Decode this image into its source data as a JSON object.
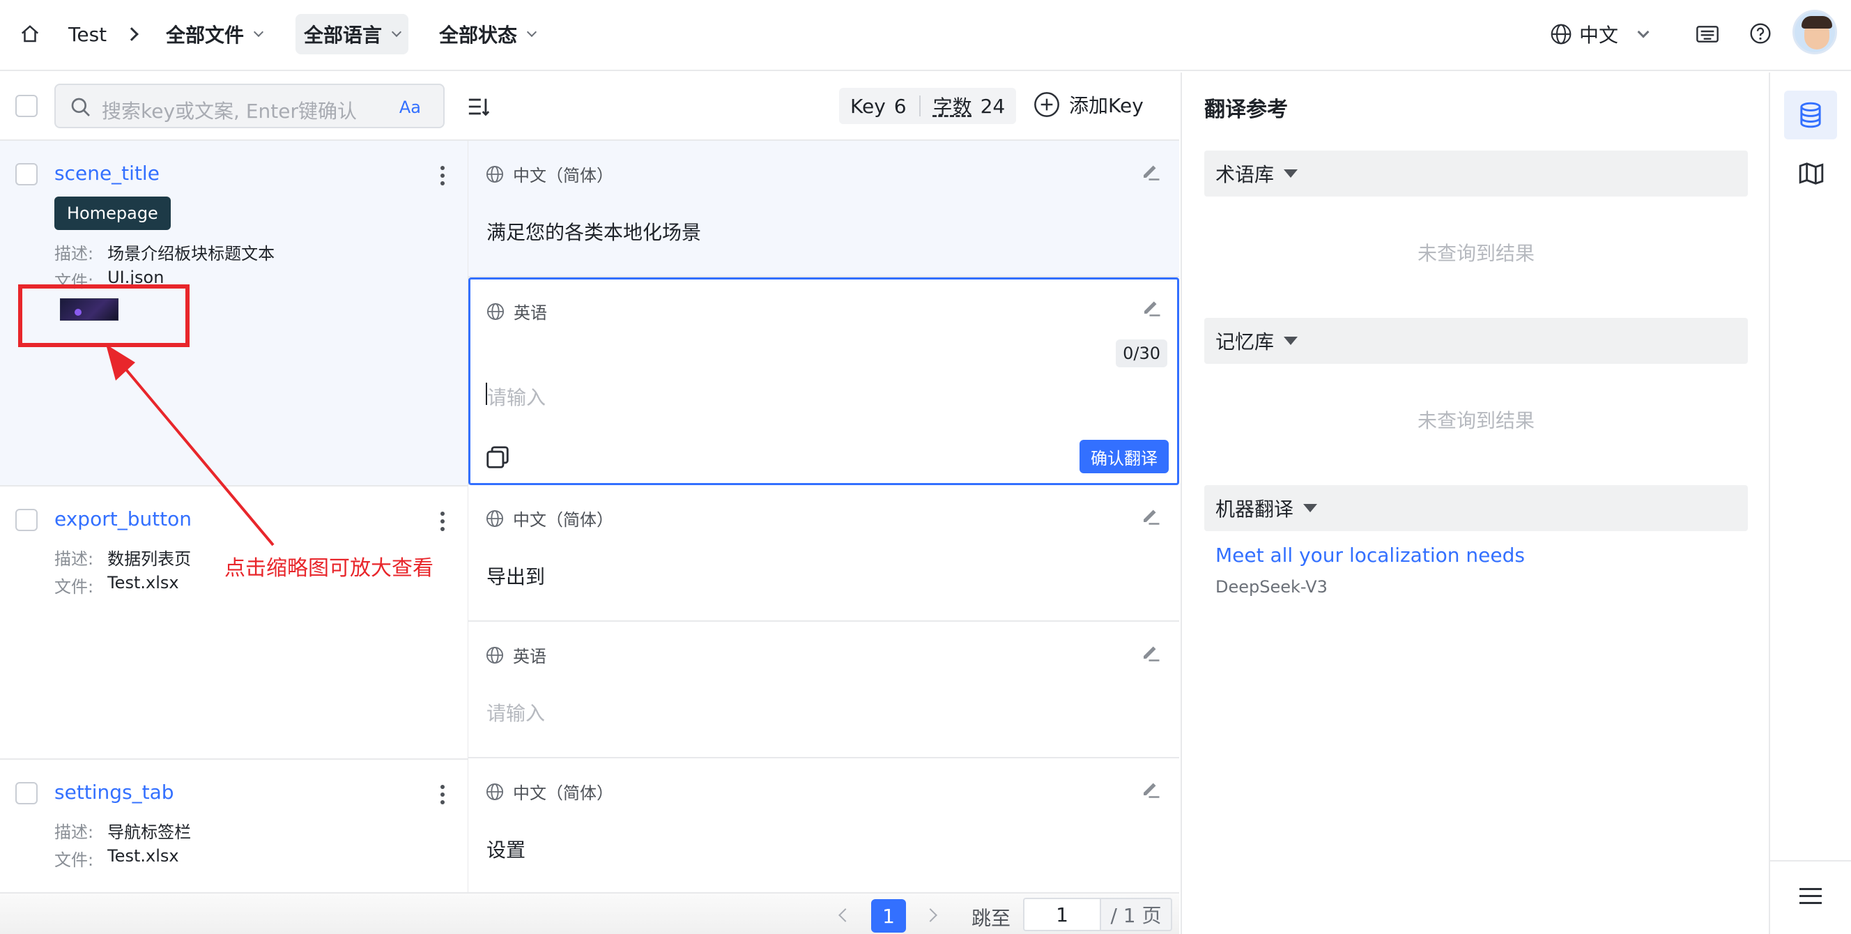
{
  "header": {
    "breadcrumb_root": "Test",
    "filters": [
      "全部文件",
      "全部语言",
      "全部状态"
    ],
    "language_selector": "中文"
  },
  "toolbar": {
    "search_placeholder": "搜索key或文案, Enter键确认",
    "case_toggle": "Aa",
    "key_label": "Key",
    "key_count": "6",
    "word_label": "字数",
    "word_count": "24",
    "add_key": "添加Key"
  },
  "labels": {
    "desc": "描述:",
    "file": "文件:"
  },
  "keys": [
    {
      "name": "scene_title",
      "tag": "Homepage",
      "description": "场景介绍板块标题文本",
      "file": "UI.json"
    },
    {
      "name": "export_button",
      "description": "数据列表页",
      "file": "Test.xlsx"
    },
    {
      "name": "settings_tab",
      "description": "导航标签栏",
      "file": "Test.xlsx"
    }
  ],
  "translations": [
    {
      "lang": "中文（简体）",
      "text": "满足您的各类本地化场景"
    },
    {
      "lang": "英语",
      "counter": "0/30",
      "placeholder": "请输入",
      "confirm": "确认翻译"
    },
    {
      "lang": "中文（简体）",
      "text": "导出到"
    },
    {
      "lang": "英语",
      "placeholder": "请输入"
    },
    {
      "lang": "中文（简体）",
      "text": "设置"
    }
  ],
  "annotation": {
    "text": "点击缩略图可放大查看",
    "color": "#e8262b"
  },
  "reference": {
    "title": "翻译参考",
    "glossary": "术语库",
    "memory": "记忆库",
    "machine": "机器翻译",
    "empty_text": "未查询到结果",
    "mt_result": "Meet all your localization needs",
    "mt_engine": "DeepSeek-V3"
  },
  "pagination": {
    "current": "1",
    "jump_label": "跳至",
    "jump_value": "1",
    "total": "/ 1 页"
  },
  "colors": {
    "accent": "#3370ff",
    "tag_bg": "#1d3a47"
  }
}
